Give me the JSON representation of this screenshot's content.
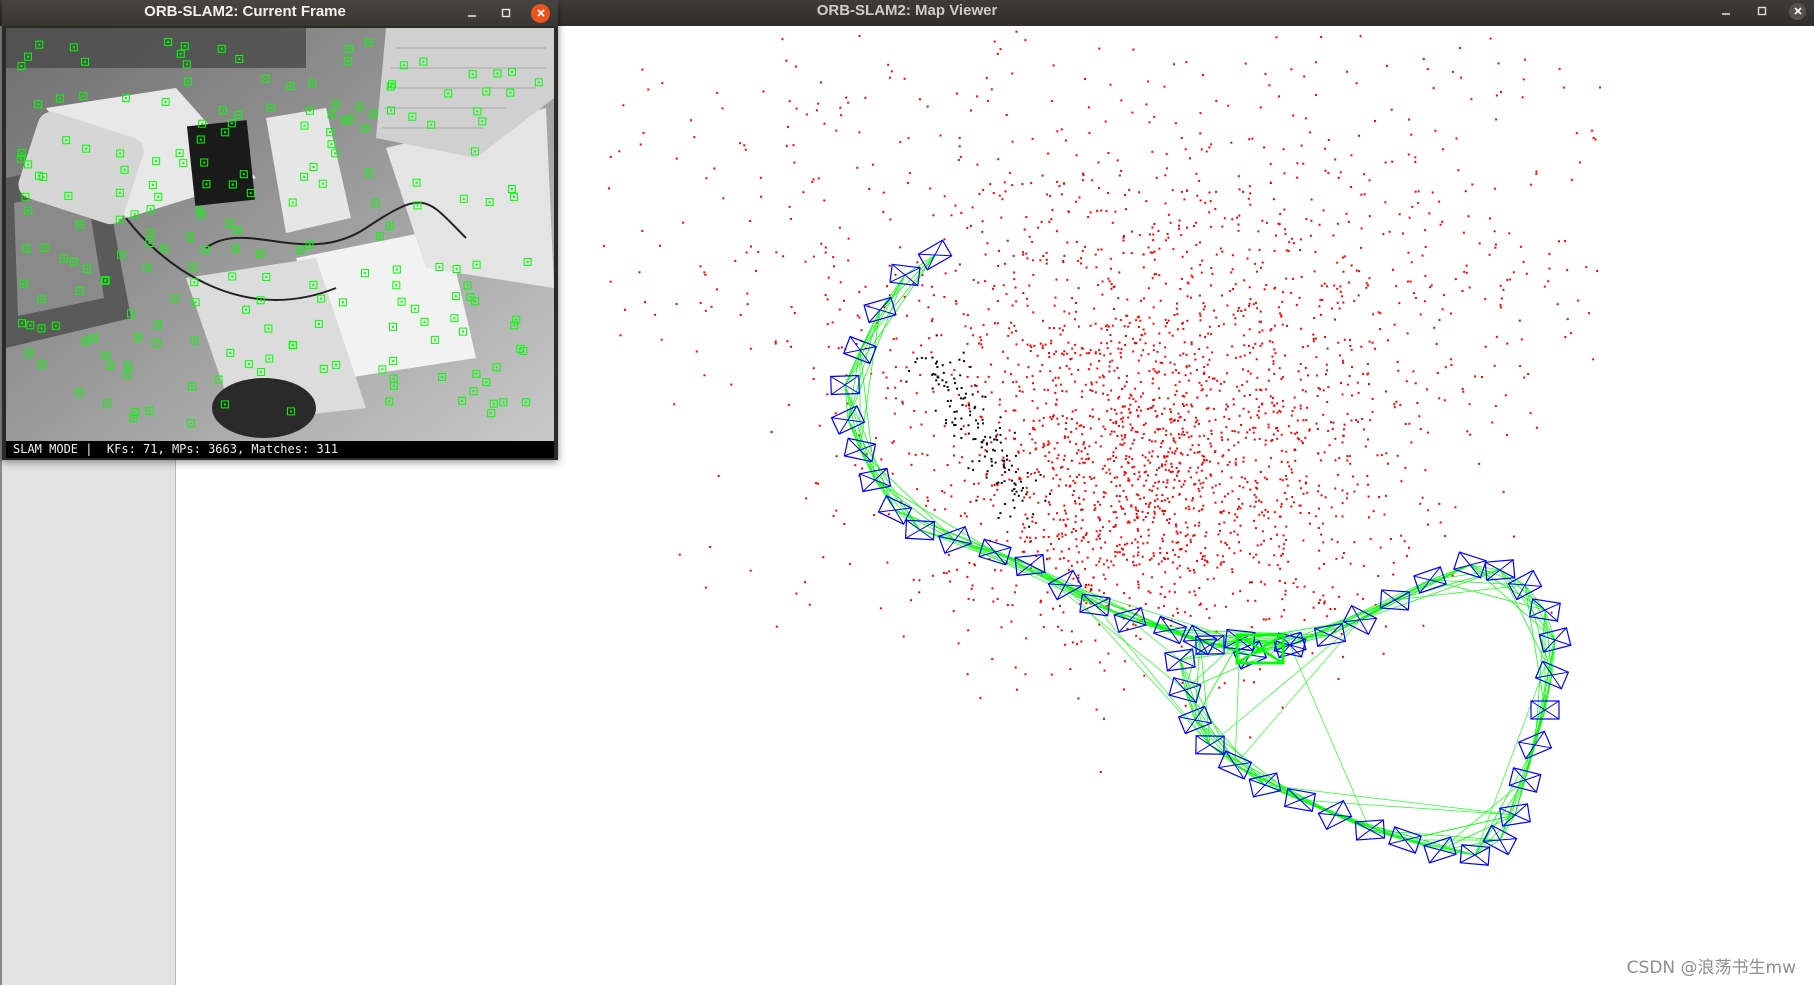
{
  "map_viewer": {
    "title": "ORB-SLAM2: Map Viewer",
    "controls": {
      "minimize_icon": "minimize-icon",
      "maximize_icon": "maximize-icon",
      "close_icon": "close-icon"
    },
    "colors": {
      "map_points": "#ff0000",
      "reference_points": "#000000",
      "keyframes": "#0000ff",
      "covisibility_graph": "#00ff00",
      "current_camera": "#00ff00"
    }
  },
  "current_frame": {
    "title": "ORB-SLAM2: Current Frame",
    "status_text": "SLAM MODE |  KFs: 71, MPs: 3663, Matches: 311",
    "controls": {
      "minimize_icon": "minimize-icon",
      "maximize_icon": "maximize-icon",
      "close_icon": "close-icon"
    },
    "colors": {
      "features": "#00ff00"
    }
  },
  "watermark": "CSDN @浪荡书生mw"
}
